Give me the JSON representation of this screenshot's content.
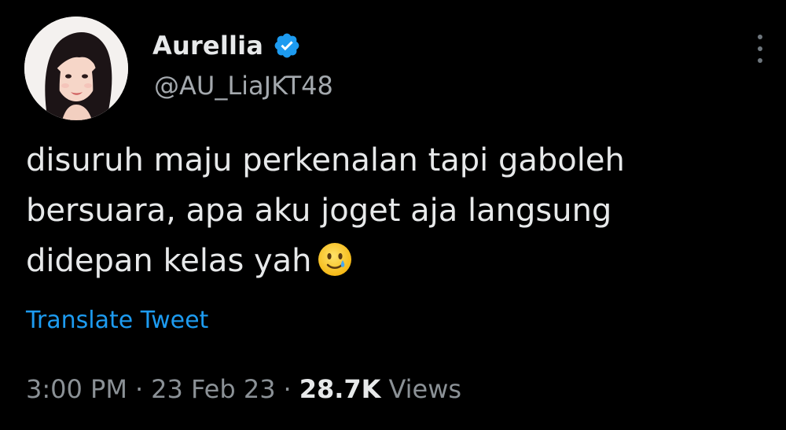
{
  "author": {
    "display_name": "Aurellia",
    "handle": "@AU_LiaJKT48",
    "verified": true,
    "avatar_icon": "avatar-photo"
  },
  "tweet": {
    "text_lines": [
      "disuruh maju perkenalan tapi gaboleh",
      "bersuara, apa aku joget aja langsung",
      "didepan kelas yah"
    ],
    "emoji": "smiling-face-with-tear"
  },
  "translate_label": "Translate Tweet",
  "meta": {
    "time": "3:00 PM",
    "separator": "·",
    "date": "23 Feb 23",
    "views_count": "28.7K",
    "views_label": "Views"
  },
  "icons": {
    "more": "more-vertical-icon",
    "verified": "verified-badge-icon"
  },
  "colors": {
    "background": "#000000",
    "text": "#e7e9ea",
    "secondary": "#8b9196",
    "link": "#1d9bf0",
    "verified": "#1d9bf0"
  }
}
